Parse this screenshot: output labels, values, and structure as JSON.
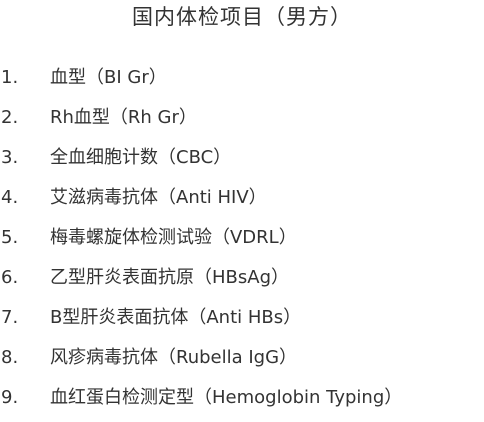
{
  "title": "国内体检项目（男方）",
  "items": [
    {
      "number": "1.",
      "text": "血型（BI Gr）"
    },
    {
      "number": "2.",
      "text": "Rh血型（Rh Gr）"
    },
    {
      "number": "3.",
      "text": "全血细胞计数（CBC）"
    },
    {
      "number": "4.",
      "text": "艾滋病毒抗体（Anti HIV）"
    },
    {
      "number": "5.",
      "text": "梅毒螺旋体检测试验（VDRL）"
    },
    {
      "number": "6.",
      "text": "乙型肝炎表面抗原（HBsAg）"
    },
    {
      "number": "7.",
      "text": "B型肝炎表面抗体（Anti HBs）"
    },
    {
      "number": "8.",
      "text": "风疹病毒抗体（Rubella IgG）"
    },
    {
      "number": "9.",
      "text": "血红蛋白检测定型（Hemoglobin Typing）"
    }
  ]
}
